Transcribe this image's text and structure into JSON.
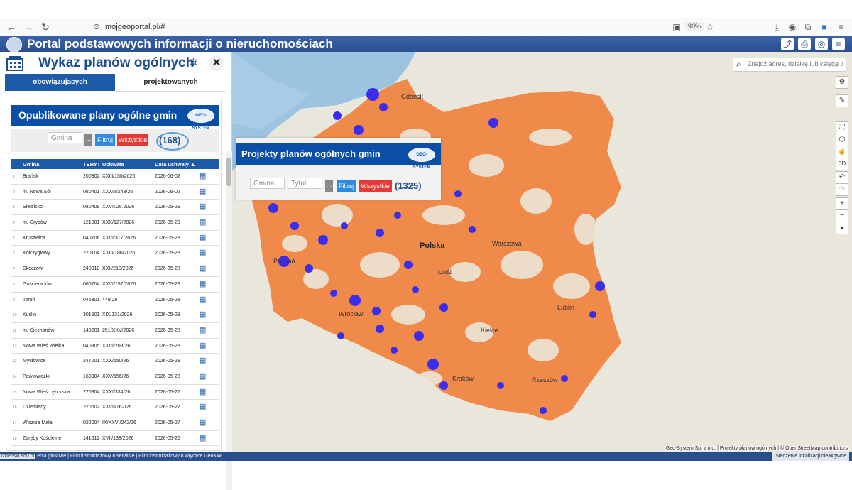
{
  "browser": {
    "url": "mojgeoportal.pl/#",
    "zoom": "90%"
  },
  "header": {
    "title": "Portal podstawowych informacji o nieruchomościach"
  },
  "panel": {
    "title": "Wykaz planów ogólnych",
    "tabs": [
      "obowiązujących",
      "projektowanych"
    ],
    "card_title": "Opublikowane plany ogólne gmin",
    "logo_text": "GEO-SYSTEM",
    "filter": {
      "gmina_placeholder": "Gmina",
      "dots": "...",
      "filter_label": "Filtruj",
      "all_label": "Wszystkie",
      "count": "(168)"
    },
    "columns": [
      "Gmina",
      "TERYT",
      "Uchwała",
      "Data uchwały ▲"
    ],
    "rows": [
      {
        "n": "1",
        "gmina": "Brańsk",
        "teryt": "200302",
        "uchwala": "XXIII/150/2026",
        "data": "2026-06-02"
      },
      {
        "n": "2",
        "gmina": "m. Nowa Sól",
        "teryt": "080401",
        "uchwala": "XXXIII/243/26",
        "data": "2026-06-02"
      },
      {
        "n": "3",
        "gmina": "Siedlisko",
        "teryt": "080408",
        "uchwala": "XXVII.25.2026",
        "data": "2026-05-29"
      },
      {
        "n": "4",
        "gmina": "m. Grybów",
        "teryt": "121001",
        "uchwala": "XXX/127/2026",
        "data": "2026-05-29"
      },
      {
        "n": "5",
        "gmina": "Kruszwica",
        "teryt": "040706",
        "uchwala": "XXVI/317/2026",
        "data": "2026-05-28"
      },
      {
        "n": "6",
        "gmina": "Kołczygłowy",
        "teryt": "220104",
        "uchwala": "XXIII/186/2026",
        "data": "2026-05-28"
      },
      {
        "n": "7",
        "gmina": "Skoczów",
        "teryt": "240310",
        "uchwala": "XXII/218/2026",
        "data": "2026-05-28"
      },
      {
        "n": "8",
        "gmina": "Gościeradów",
        "teryt": "060704",
        "uchwala": "XXVI/157/2026",
        "data": "2026-05-28"
      },
      {
        "n": "9",
        "gmina": "Toruń",
        "teryt": "046301",
        "uchwala": "449/26",
        "data": "2026-05-28"
      },
      {
        "n": "10",
        "gmina": "Kuślin",
        "teryt": "301501",
        "uchwala": "XIX/131/2026",
        "data": "2026-05-28"
      },
      {
        "n": "11",
        "gmina": "m. Ciechanów",
        "teryt": "140201",
        "uchwala": "251/XXV/2026",
        "data": "2026-05-28"
      },
      {
        "n": "12",
        "gmina": "Nowa Wieś Wielka",
        "teryt": "040305",
        "uchwala": "XXVI/203/26",
        "data": "2026-05-28"
      },
      {
        "n": "13",
        "gmina": "Mysłowice",
        "teryt": "247001",
        "uchwala": "XXX/650/26",
        "data": "2026-05-28"
      },
      {
        "n": "14",
        "gmina": "Pawłowiczki",
        "teryt": "160304",
        "uchwala": "XXV/156/26",
        "data": "2026-05-28"
      },
      {
        "n": "15",
        "gmina": "Nowa Wieś Lęborska",
        "teryt": "220804",
        "uchwala": "XXXI/334/26",
        "data": "2026-05-27"
      },
      {
        "n": "16",
        "gmina": "Dziemiany",
        "teryt": "220602",
        "uchwala": "XXVII/162/26",
        "data": "2026-05-27"
      },
      {
        "n": "17",
        "gmina": "Wisznia Mała",
        "teryt": "022004",
        "uchwala": "IX/XXVI/242/26",
        "data": "2026-05-27"
      },
      {
        "n": "18",
        "gmina": "Zaręby Kościelne",
        "teryt": "141611",
        "uchwala": "XVII/138/2026",
        "data": "2026-05-26"
      }
    ]
  },
  "projects": {
    "title": "Projekty planów ogólnych gmin",
    "gmina_placeholder": "Gmina",
    "tytul_placeholder": "Tytuł",
    "dots": "...",
    "filter_label": "Filtruj",
    "all_label": "Wszystkie",
    "count": "(1325)"
  },
  "map": {
    "search_placeholder": "Znajdź adres, działkę lub księgę wieczystą",
    "places": [
      "Gdańsk",
      "Polska",
      "Warszawa",
      "Łódź",
      "Wrocław",
      "Kielce",
      "Kraków",
      "Rzeszów",
      "Lublin",
      "Poznań"
    ],
    "tools": [
      "⚙",
      "✎",
      "⛶",
      "⬡",
      "☝",
      "3D",
      "↶",
      "↷",
      "+",
      "−",
      "▲"
    ],
    "colors": {
      "adopted": "#3a2df0",
      "project": "#f08a4a",
      "land": "#e9e6dc",
      "water": "#9cc3e0"
    }
  },
  "status": {
    "left_link": "izdebski.edu.pl",
    "left_text": "enia głosowe | Film instruktażowy o serwisie | Film instruktażowy o wtyczce GeoKW",
    "attribution": "Geo-System Sp. z o.o. | Projekty planów ogólnych | © OpenStreetMap contributors",
    "location": "Śledzenie lokalizacji nieaktywne"
  }
}
